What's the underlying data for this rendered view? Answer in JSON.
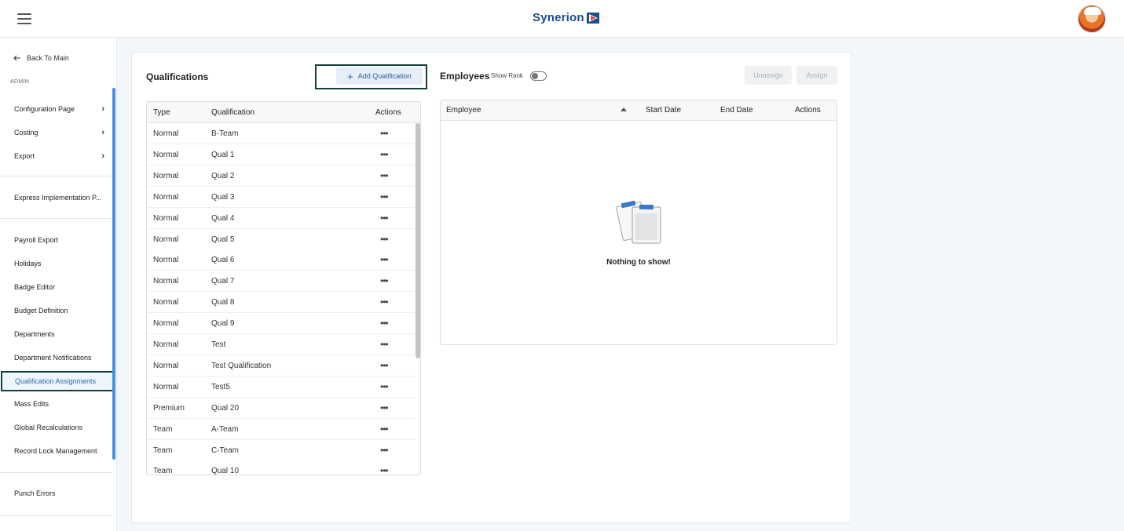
{
  "header": {
    "logo_text": "Synerion",
    "brand_color": "#1a4f8b",
    "menu_icon": "hamburger-icon",
    "avatar_icon": "user-avatar"
  },
  "sidebar": {
    "back_label": "Back To Main",
    "section_label": "ADMIN",
    "group1": [
      {
        "label": "Configuration Page",
        "has_submenu": true
      },
      {
        "label": "Costing",
        "has_submenu": true
      },
      {
        "label": "Export",
        "has_submenu": true
      }
    ],
    "express_label": "Express Implementation P...",
    "group2": [
      {
        "label": "Payroll Export"
      },
      {
        "label": "Holidays"
      },
      {
        "label": "Badge Editor"
      },
      {
        "label": "Budget Definition"
      },
      {
        "label": "Departments"
      },
      {
        "label": "Department Notifications"
      },
      {
        "label": "Qualification Assignments",
        "active": true
      },
      {
        "label": "Mass Edits"
      },
      {
        "label": "Global Recalculations"
      },
      {
        "label": "Record Lock Management"
      }
    ],
    "punch_errors_label": "Punch Errors",
    "accent_color": "#4a90e2"
  },
  "qualifications": {
    "title": "Qualifications",
    "add_button_label": "Add Qualification",
    "columns": [
      "Type",
      "Qualification",
      "Actions"
    ],
    "rows": [
      {
        "type": "Normal",
        "name": "B-Team"
      },
      {
        "type": "Normal",
        "name": "Qual 1"
      },
      {
        "type": "Normal",
        "name": "Qual 2"
      },
      {
        "type": "Normal",
        "name": "Qual 3"
      },
      {
        "type": "Normal",
        "name": "Qual 4"
      },
      {
        "type": "Normal",
        "name": "Qual 5"
      },
      {
        "type": "Normal",
        "name": "Qual 6"
      },
      {
        "type": "Normal",
        "name": "Qual 7"
      },
      {
        "type": "Normal",
        "name": "Qual 8"
      },
      {
        "type": "Normal",
        "name": "Qual 9"
      },
      {
        "type": "Normal",
        "name": "Test"
      },
      {
        "type": "Normal",
        "name": "Test Qualification"
      },
      {
        "type": "Normal",
        "name": "Test5"
      },
      {
        "type": "Premium",
        "name": "Qual 20"
      },
      {
        "type": "Team",
        "name": "A-Team"
      },
      {
        "type": "Team",
        "name": "C-Team"
      },
      {
        "type": "Team",
        "name": "Qual 10"
      }
    ],
    "actions_glyph": "•••"
  },
  "employees": {
    "title": "Employees",
    "show_rank_label": "Show Rank",
    "show_rank_on": false,
    "unassign_label": "Unassign",
    "assign_label": "Assign",
    "columns": [
      "Employee",
      "Start Date",
      "End Date",
      "Actions"
    ],
    "sort_column": "Employee",
    "sort_direction": "ascending",
    "empty_message": "Nothing to show!",
    "empty_icon": "clipboard-icon"
  }
}
